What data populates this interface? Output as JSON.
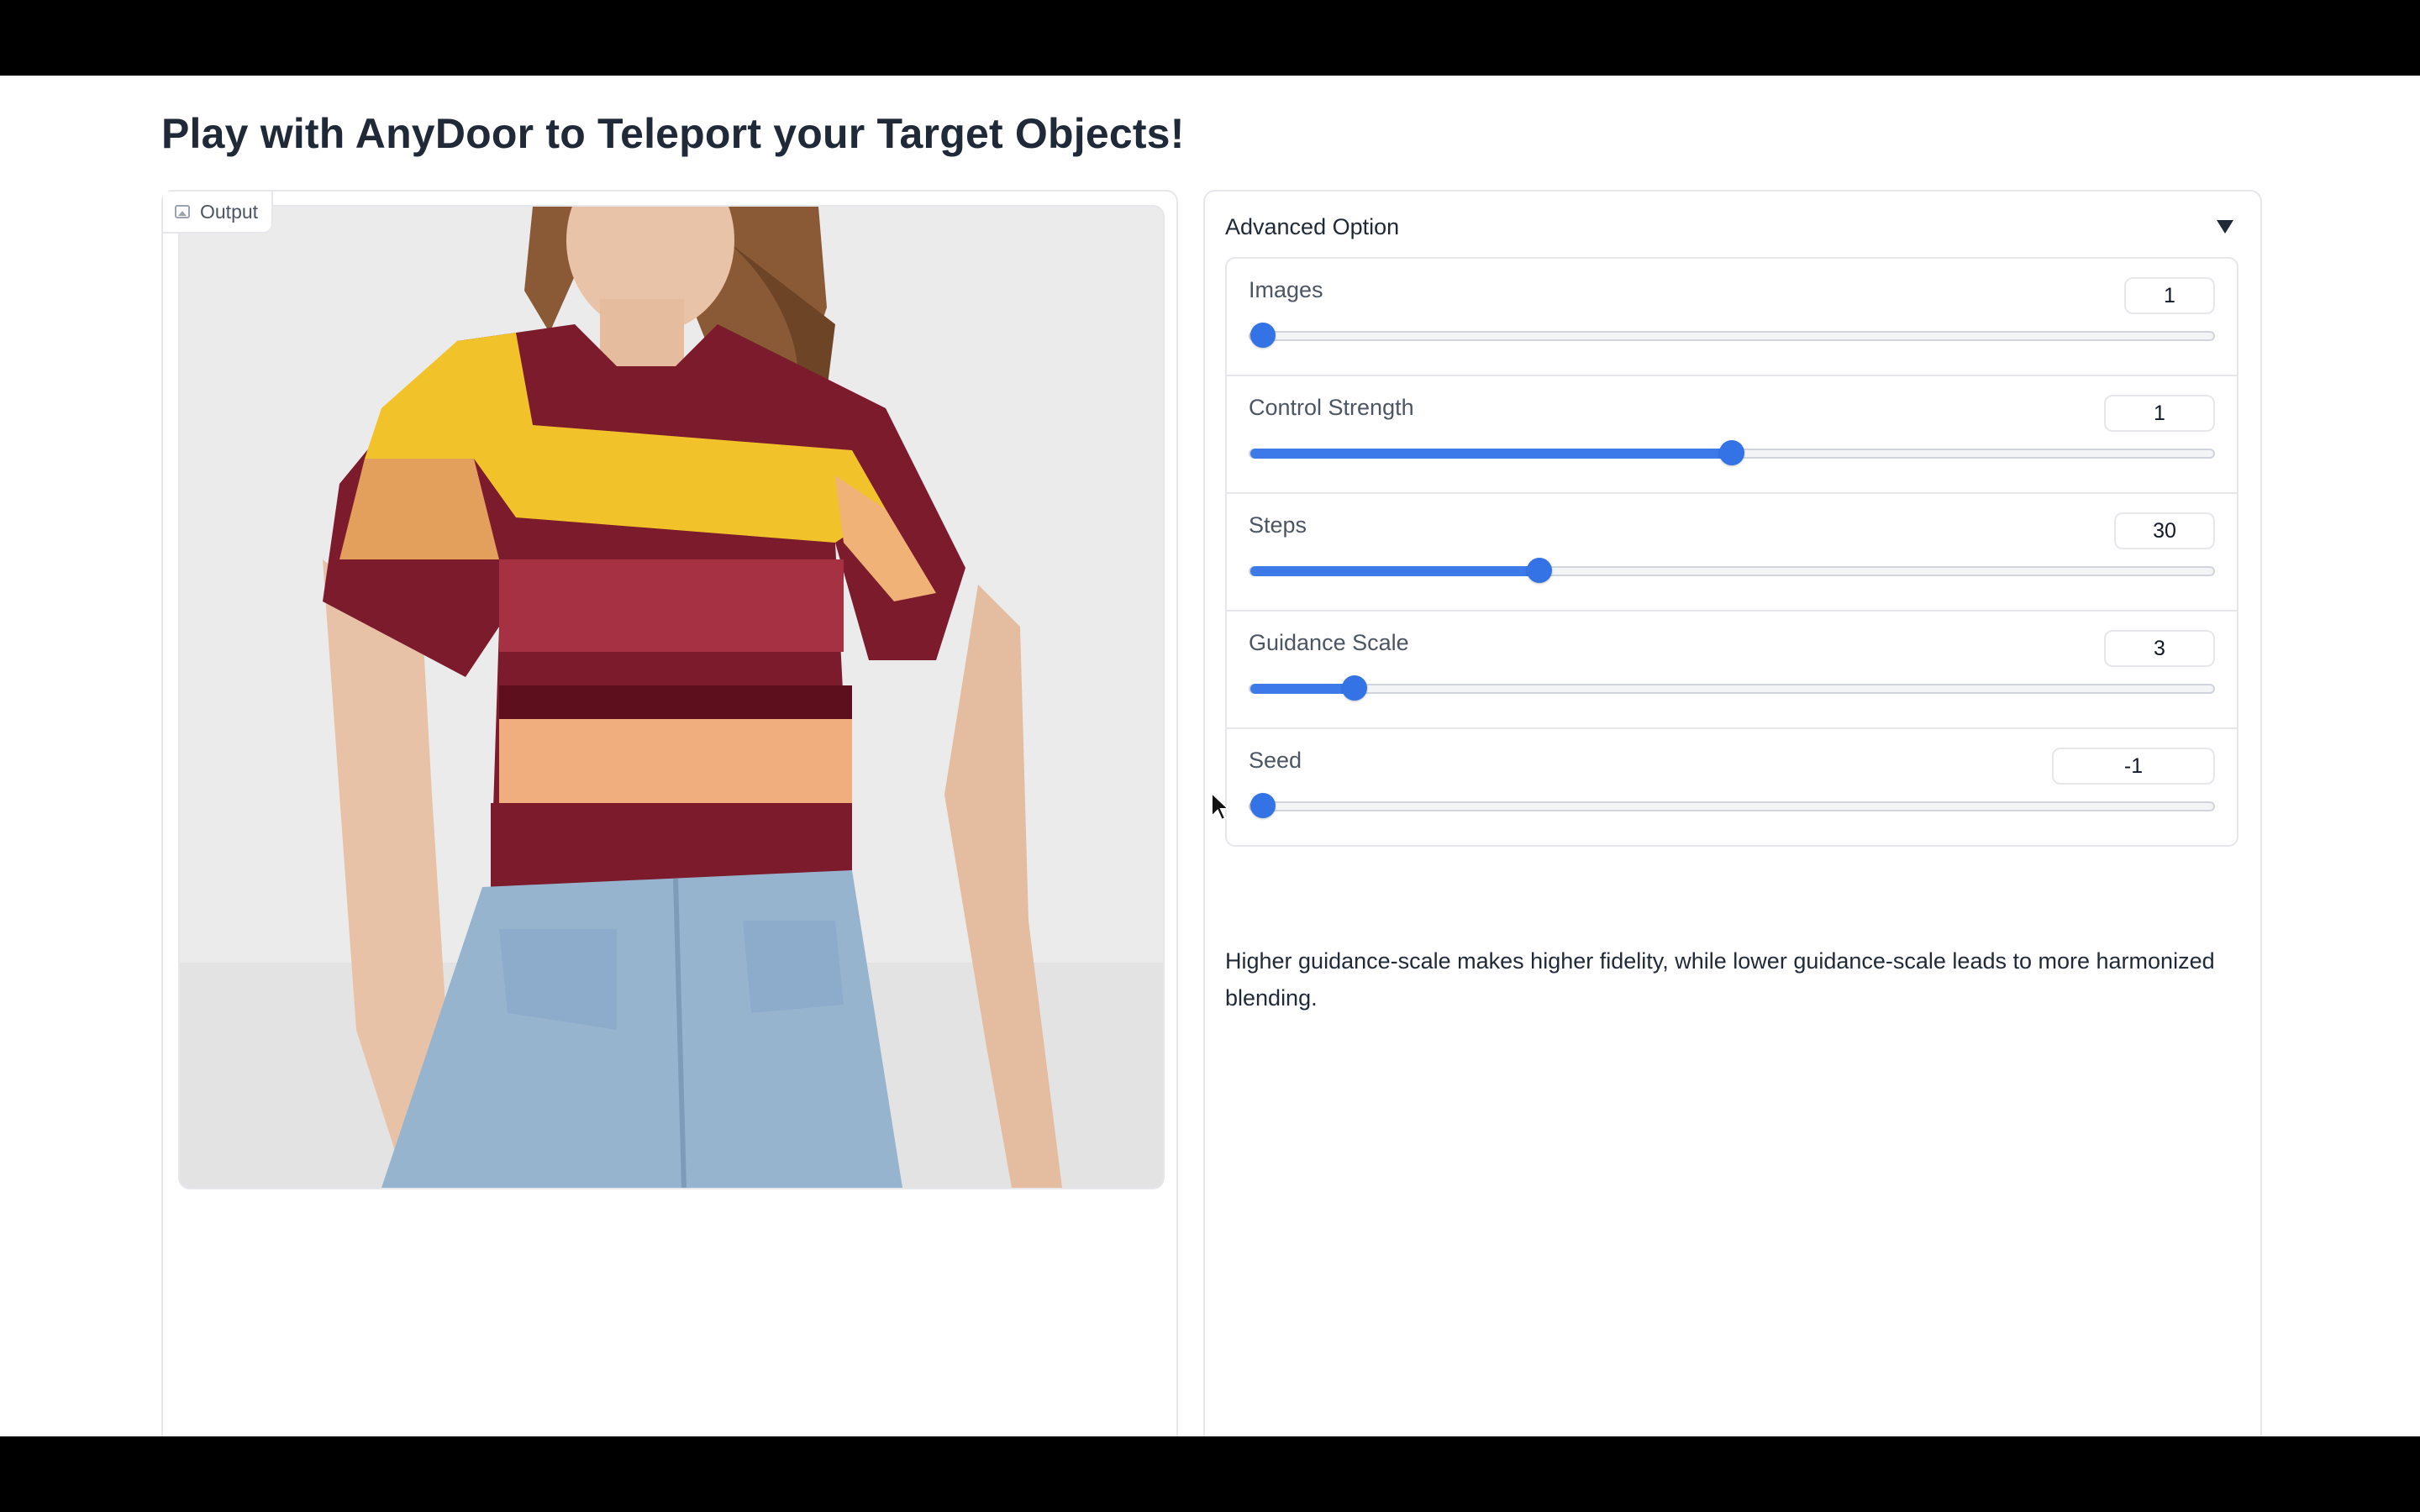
{
  "page": {
    "title": "Play with AnyDoor to Teleport your Target Objects!"
  },
  "output": {
    "label": "Output",
    "icon": "image-icon"
  },
  "advanced": {
    "header": "Advanced Option",
    "expanded": true,
    "sliders": [
      {
        "label": "Images",
        "value": "1",
        "fraction": 0.0
      },
      {
        "label": "Control Strength",
        "value": "1",
        "fraction": 0.5
      },
      {
        "label": "Steps",
        "value": "30",
        "fraction": 0.3
      },
      {
        "label": "Guidance Scale",
        "value": "3",
        "fraction": 0.108
      },
      {
        "label": "Seed",
        "value": "-1",
        "fraction": 0.0
      }
    ],
    "note": "Higher guidance-scale makes higher fidelity, while lower guidance-scale leads to more harmonized blending."
  },
  "colors": {
    "accent": "#3473e6",
    "border": "#e5e7eb"
  }
}
